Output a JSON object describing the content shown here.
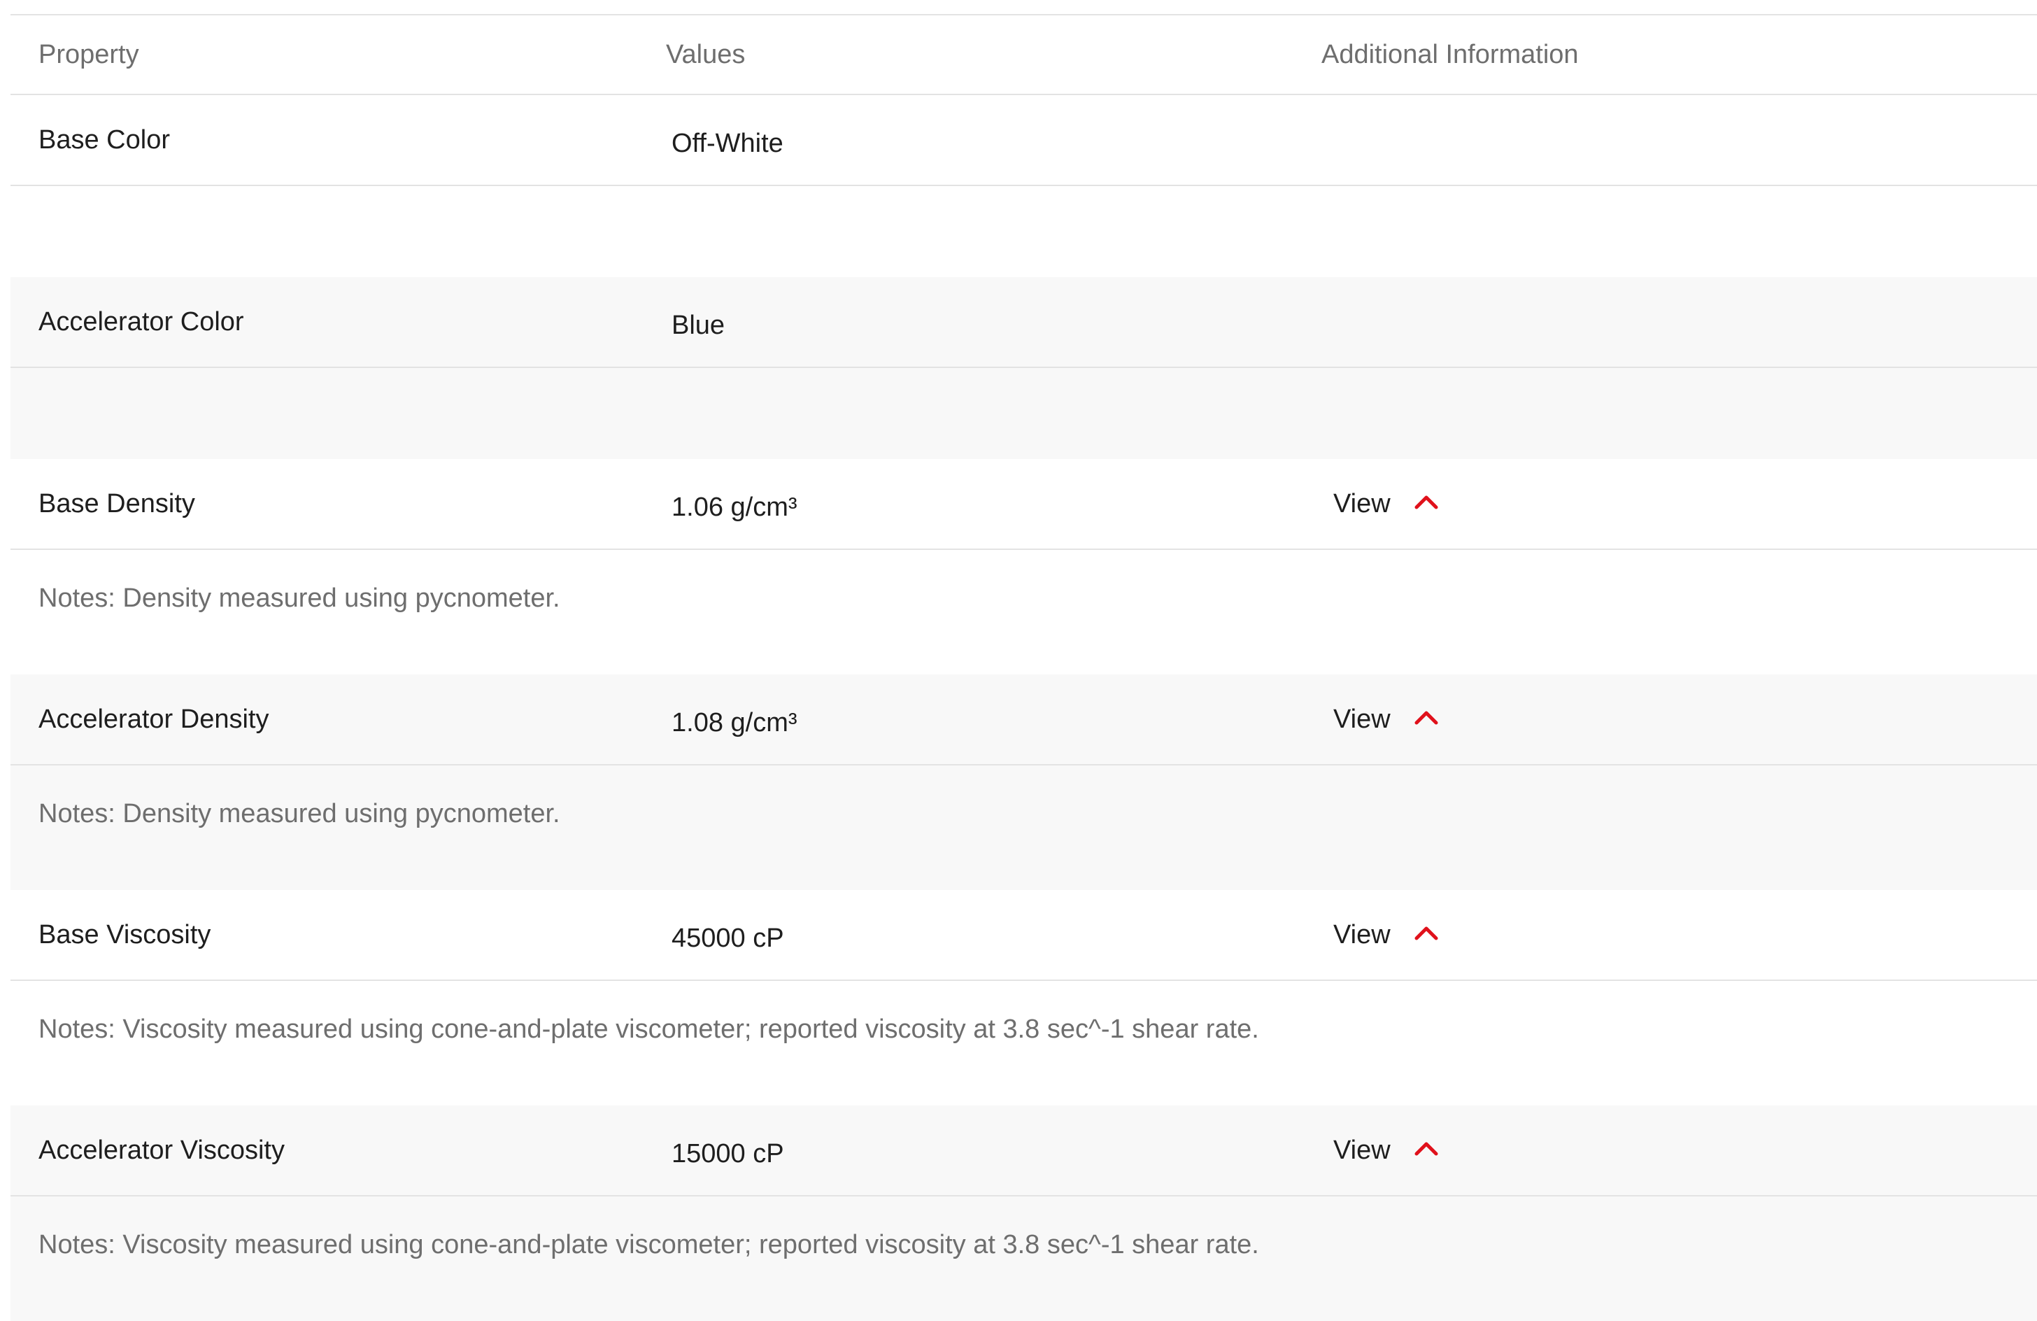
{
  "table": {
    "headers": {
      "property": "Property",
      "values": "Values",
      "additional": "Additional Information"
    },
    "rows": [
      {
        "property": "Base Color",
        "value": "Off-White",
        "view": "",
        "notes": ""
      },
      {
        "property": "Accelerator Color",
        "value": "Blue",
        "view": "",
        "notes": ""
      },
      {
        "property": "Base Density",
        "value": "1.06 g/cm³",
        "view": "View",
        "notes": "Notes: Density measured using pycnometer."
      },
      {
        "property": "Accelerator Density",
        "value": "1.08 g/cm³",
        "view": "View",
        "notes": "Notes: Density measured using pycnometer."
      },
      {
        "property": "Base Viscosity",
        "value": "45000 cP",
        "view": "View",
        "notes": "Notes: Viscosity measured using cone-and-plate viscometer; reported viscosity at 3.8 sec^-1 shear rate."
      },
      {
        "property": "Accelerator Viscosity",
        "value": "15000 cP",
        "view": "View",
        "notes": "Notes: Viscosity measured using cone-and-plate viscometer; reported viscosity at 3.8 sec^-1 shear rate."
      }
    ]
  },
  "colors": {
    "accent": "#e0111b",
    "shaded_row": "#f8f8f8",
    "divider": "#e3e3e3",
    "muted_text": "#6e6e6e"
  },
  "icons": {
    "expand_toggle": "chevron-up-icon"
  }
}
